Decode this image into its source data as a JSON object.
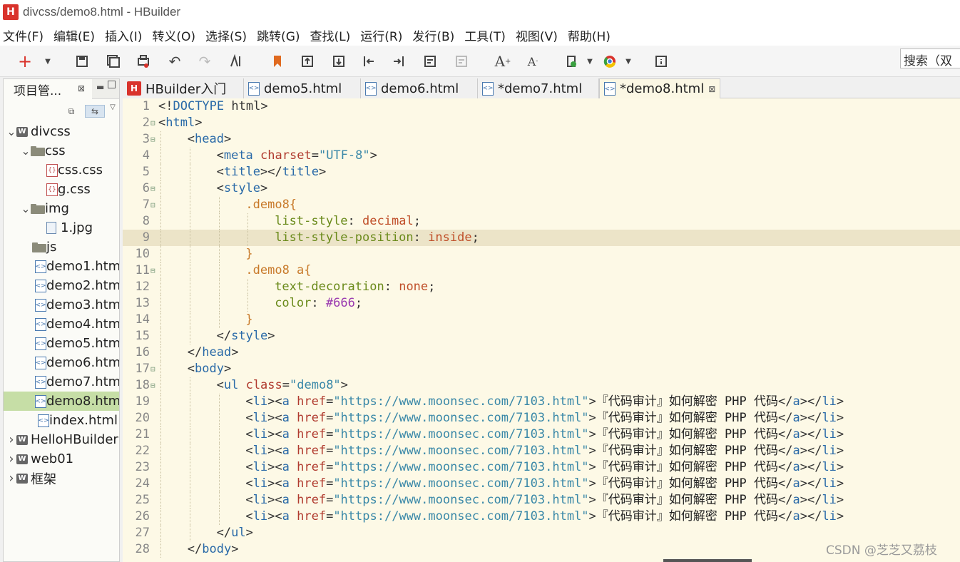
{
  "window": {
    "title": "divcss/demo8.html  -  HBuilder",
    "logo": "H"
  },
  "menu": [
    "文件(F)",
    "编辑(E)",
    "插入(I)",
    "转义(O)",
    "选择(S)",
    "跳转(G)",
    "查找(L)",
    "运行(R)",
    "发行(B)",
    "工具(T)",
    "视图(V)",
    "帮助(H)"
  ],
  "toolbar": {
    "search_label": "搜索（双"
  },
  "panel": {
    "title": "项目管..."
  },
  "tree": [
    {
      "label": "divcss",
      "type": "project",
      "arrow": "v"
    },
    {
      "label": "css",
      "type": "folder",
      "arrow": "v"
    },
    {
      "label": "css.css",
      "type": "css",
      "arrow": ""
    },
    {
      "label": "g.css",
      "type": "css",
      "arrow": ""
    },
    {
      "label": "img",
      "type": "folder",
      "arrow": "v"
    },
    {
      "label": "1.jpg",
      "type": "image",
      "arrow": ""
    },
    {
      "label": "js",
      "type": "folder",
      "arrow": ""
    },
    {
      "label": "demo1.htm",
      "type": "html",
      "arrow": ""
    },
    {
      "label": "demo2.htm",
      "type": "html",
      "arrow": ""
    },
    {
      "label": "demo3.htm",
      "type": "html",
      "arrow": ""
    },
    {
      "label": "demo4.htm",
      "type": "html",
      "arrow": ""
    },
    {
      "label": "demo5.htm",
      "type": "html",
      "arrow": ""
    },
    {
      "label": "demo6.htm",
      "type": "html",
      "arrow": ""
    },
    {
      "label": "demo7.htm",
      "type": "html",
      "arrow": ""
    },
    {
      "label": "demo8.htm",
      "type": "html",
      "arrow": "",
      "selected": true
    },
    {
      "label": "index.html",
      "type": "html",
      "arrow": ""
    },
    {
      "label": "HelloHBuilder",
      "type": "project",
      "arrow": ">"
    },
    {
      "label": "web01",
      "type": "project",
      "arrow": ">"
    },
    {
      "label": "框架",
      "type": "project",
      "arrow": ">"
    }
  ],
  "tabs": [
    {
      "label": "HBuilder入门",
      "kind": "h"
    },
    {
      "label": "demo5.html",
      "kind": "html"
    },
    {
      "label": "demo6.html",
      "kind": "html"
    },
    {
      "label": "*demo7.html",
      "kind": "html"
    },
    {
      "label": "*demo8.html",
      "kind": "html",
      "active": true
    }
  ],
  "code": [
    {
      "n": "1",
      "fold": false,
      "indent": 0,
      "toks": [
        [
          "t-punct",
          "<!"
        ],
        [
          "t-tag",
          "DOCTYPE"
        ],
        [
          "t-punct",
          " html>"
        ]
      ]
    },
    {
      "n": "2",
      "fold": true,
      "indent": 0,
      "toks": [
        [
          "t-punct",
          "<"
        ],
        [
          "t-tag",
          "html"
        ],
        [
          "t-punct",
          ">"
        ]
      ]
    },
    {
      "n": "3",
      "fold": true,
      "indent": 1,
      "toks": [
        [
          "t-punct",
          "<"
        ],
        [
          "t-tag",
          "head"
        ],
        [
          "t-punct",
          ">"
        ]
      ]
    },
    {
      "n": "4",
      "fold": false,
      "indent": 2,
      "toks": [
        [
          "t-punct",
          "<"
        ],
        [
          "t-tag",
          "meta"
        ],
        [
          "t-punct",
          " "
        ],
        [
          "t-attr",
          "charset"
        ],
        [
          "t-punct",
          "="
        ],
        [
          "t-str",
          "\"UTF-8\""
        ],
        [
          "t-punct",
          ">"
        ]
      ]
    },
    {
      "n": "5",
      "fold": false,
      "indent": 2,
      "toks": [
        [
          "t-punct",
          "<"
        ],
        [
          "t-tag",
          "title"
        ],
        [
          "t-punct",
          "></"
        ],
        [
          "t-tag",
          "title"
        ],
        [
          "t-punct",
          ">"
        ]
      ]
    },
    {
      "n": "6",
      "fold": true,
      "indent": 2,
      "toks": [
        [
          "t-punct",
          "<"
        ],
        [
          "t-tag",
          "style"
        ],
        [
          "t-punct",
          ">"
        ]
      ]
    },
    {
      "n": "7",
      "fold": true,
      "indent": 3,
      "toks": [
        [
          "t-sel",
          ".demo8{"
        ]
      ]
    },
    {
      "n": "8",
      "fold": false,
      "indent": 4,
      "toks": [
        [
          "t-prop",
          "list-style"
        ],
        [
          "t-punct",
          ": "
        ],
        [
          "t-val",
          "decimal"
        ],
        [
          "t-punct",
          ";"
        ]
      ]
    },
    {
      "n": "9",
      "fold": false,
      "indent": 4,
      "hl": true,
      "toks": [
        [
          "t-prop",
          "list-style-position"
        ],
        [
          "t-punct",
          ": "
        ],
        [
          "t-val",
          "inside"
        ],
        [
          "t-punct",
          ";"
        ]
      ]
    },
    {
      "n": "10",
      "fold": false,
      "indent": 3,
      "toks": [
        [
          "t-sel",
          "}"
        ]
      ]
    },
    {
      "n": "11",
      "fold": true,
      "indent": 3,
      "toks": [
        [
          "t-sel",
          ".demo8 a{"
        ]
      ]
    },
    {
      "n": "12",
      "fold": false,
      "indent": 4,
      "toks": [
        [
          "t-prop",
          "text-decoration"
        ],
        [
          "t-punct",
          ": "
        ],
        [
          "t-val",
          "none"
        ],
        [
          "t-punct",
          ";"
        ]
      ]
    },
    {
      "n": "13",
      "fold": false,
      "indent": 4,
      "toks": [
        [
          "t-prop",
          "color"
        ],
        [
          "t-punct",
          ": "
        ],
        [
          "t-hex",
          "#666"
        ],
        [
          "t-punct",
          ";"
        ]
      ]
    },
    {
      "n": "14",
      "fold": false,
      "indent": 3,
      "toks": [
        [
          "t-sel",
          "}"
        ]
      ]
    },
    {
      "n": "15",
      "fold": false,
      "indent": 2,
      "toks": [
        [
          "t-punct",
          "</"
        ],
        [
          "t-tag",
          "style"
        ],
        [
          "t-punct",
          ">"
        ]
      ]
    },
    {
      "n": "16",
      "fold": false,
      "indent": 1,
      "toks": [
        [
          "t-punct",
          "</"
        ],
        [
          "t-tag",
          "head"
        ],
        [
          "t-punct",
          ">"
        ]
      ]
    },
    {
      "n": "17",
      "fold": true,
      "indent": 1,
      "toks": [
        [
          "t-punct",
          "<"
        ],
        [
          "t-tag",
          "body"
        ],
        [
          "t-punct",
          ">"
        ]
      ]
    },
    {
      "n": "18",
      "fold": true,
      "indent": 2,
      "toks": [
        [
          "t-punct",
          "<"
        ],
        [
          "t-tag",
          "ul"
        ],
        [
          "t-punct",
          " "
        ],
        [
          "t-attr",
          "class"
        ],
        [
          "t-punct",
          "="
        ],
        [
          "t-str",
          "\"demo8\""
        ],
        [
          "t-punct",
          ">"
        ]
      ]
    },
    {
      "n": "19",
      "fold": false,
      "indent": 3,
      "li": true
    },
    {
      "n": "20",
      "fold": false,
      "indent": 3,
      "li": true
    },
    {
      "n": "21",
      "fold": false,
      "indent": 3,
      "li": true
    },
    {
      "n": "22",
      "fold": false,
      "indent": 3,
      "li": true
    },
    {
      "n": "23",
      "fold": false,
      "indent": 3,
      "li": true
    },
    {
      "n": "24",
      "fold": false,
      "indent": 3,
      "li": true
    },
    {
      "n": "25",
      "fold": false,
      "indent": 3,
      "li": true
    },
    {
      "n": "26",
      "fold": false,
      "indent": 3,
      "li": true
    },
    {
      "n": "27",
      "fold": false,
      "indent": 2,
      "toks": [
        [
          "t-punct",
          "</"
        ],
        [
          "t-tag",
          "ul"
        ],
        [
          "t-punct",
          ">"
        ]
      ]
    },
    {
      "n": "28",
      "fold": false,
      "indent": 1,
      "toks": [
        [
          "t-punct",
          "</"
        ],
        [
          "t-tag",
          "body"
        ],
        [
          "t-punct",
          ">"
        ]
      ]
    }
  ],
  "li_toks": [
    [
      "t-punct",
      "<"
    ],
    [
      "t-tag",
      "li"
    ],
    [
      "t-punct",
      "><"
    ],
    [
      "t-tag",
      "a"
    ],
    [
      "t-punct",
      " "
    ],
    [
      "t-attr",
      "href"
    ],
    [
      "t-punct",
      "="
    ],
    [
      "t-str",
      "\"https://www.moonsec.com/7103.html\""
    ],
    [
      "t-punct",
      ">"
    ],
    [
      "t-txt",
      "『代码审计』如何解密 PHP 代码"
    ],
    [
      "t-punct",
      "</"
    ],
    [
      "t-tag",
      "a"
    ],
    [
      "t-punct",
      "></"
    ],
    [
      "t-tag",
      "li"
    ],
    [
      "t-punct",
      ">"
    ]
  ],
  "watermark": "CSDN @芝芝又荔枝"
}
